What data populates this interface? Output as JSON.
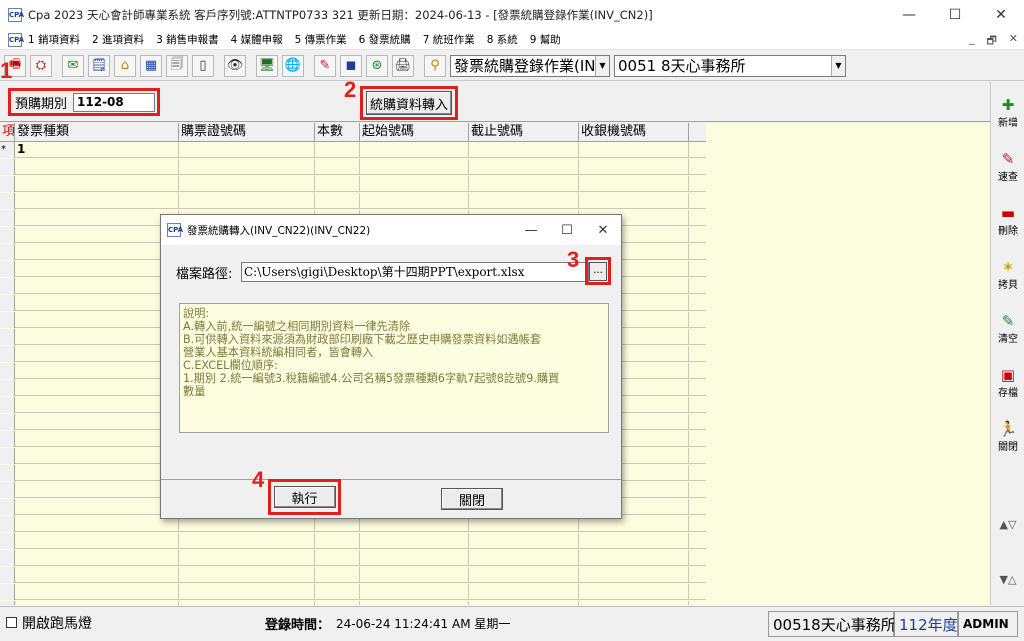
{
  "window": {
    "app_icon": "CPA",
    "title": "Cpa 2023  天心會計師專業系統  客戶序列號:ATTNTP0733 321   更新日期：2024-06-13 - [發票統購登錄作業(INV_CN2)]",
    "controls": [
      "—",
      "☐",
      "✕"
    ]
  },
  "menu": {
    "items": [
      "1 銷項資料",
      "2 進項資料",
      "3 銷售申報書",
      "4 媒體申報",
      "5 傳票作業",
      "6 發票統購",
      "7 統班作業",
      "8 系統",
      "9 幫助"
    ],
    "mdi_controls": [
      "_",
      "🗗",
      "✕"
    ]
  },
  "toolbar": {
    "icons": [
      "🖷",
      "⛭",
      "✉",
      "🗒",
      "⌂",
      "▦",
      "🗐",
      "▯",
      "👁",
      "🖥",
      "🌐",
      "✎",
      "◼",
      "⊛",
      "🖨",
      "⚲"
    ],
    "form_select": "發票統購登錄作業(IN\\",
    "company_select": "0051  8天心事務所"
  },
  "filter": {
    "period_label": "預購期別",
    "period_value": "112-08",
    "convert_button": "統購資料轉入"
  },
  "badges": [
    "1",
    "2",
    "3",
    "4"
  ],
  "grid": {
    "index_header": "項",
    "columns": [
      "發票種類",
      "購票證號碼",
      "本數",
      "起始號碼",
      "截止號碼",
      "收銀機號碼"
    ],
    "first_row_marker": "*",
    "first_row_index": "1"
  },
  "right_panel": {
    "buttons": [
      {
        "icon": "✚",
        "label": "新增",
        "color": "#1f8c2a"
      },
      {
        "icon": "✎",
        "label": "速查",
        "color": "#b22"
      },
      {
        "icon": "▬",
        "label": "刪除",
        "color": "#c00"
      },
      {
        "icon": "✶",
        "label": "拷貝",
        "color": "#d4a000"
      },
      {
        "icon": "✎",
        "label": "清空",
        "color": "#1f8c2a"
      },
      {
        "icon": "▣",
        "label": "存檔",
        "color": "#c00"
      },
      {
        "icon": "🏃",
        "label": "關閉",
        "color": "#1f8c2a"
      }
    ],
    "nav": [
      "▲▽",
      "▼△"
    ]
  },
  "status": {
    "marquee_label": "開啟跑馬燈",
    "login_label": "登錄時間：",
    "login_value": "24-06-24 11:24:41 AM  星期一",
    "company": "00518天心事務所",
    "year": "112年度",
    "user": "ADMIN"
  },
  "dialog": {
    "title": "發票統購轉入(INV_CN22)(INV_CN22)",
    "controls": [
      "—",
      "☐",
      "✕"
    ],
    "path_label": "檔案路徑:",
    "path_value": "C:\\Users\\gigi\\Desktop\\第十四期PPT\\export.xlsx",
    "browse_label": "...",
    "notes": [
      "說明:",
      "A.轉入前,統一編號之相同期別資料一律先清除",
      "B.可供轉入資料來源須為財政部印刷廠下載之歷史申購發票資料如遇帳套",
      "營業人基本資料統編相同者，皆會轉入",
      "C.EXCEL欄位順序:",
      "1.期別 2.統一編號3.稅籍編號4.公司名稱5發票種類6字軌7起號8訖號9.購買",
      "數量"
    ],
    "execute_button": "執行",
    "close_button": "關閉"
  },
  "colors": {
    "annotation": "#e0201b",
    "grid_background": "#fcfcde",
    "notes_text": "#7c7c3e",
    "year_text": "#1a3e9a"
  }
}
